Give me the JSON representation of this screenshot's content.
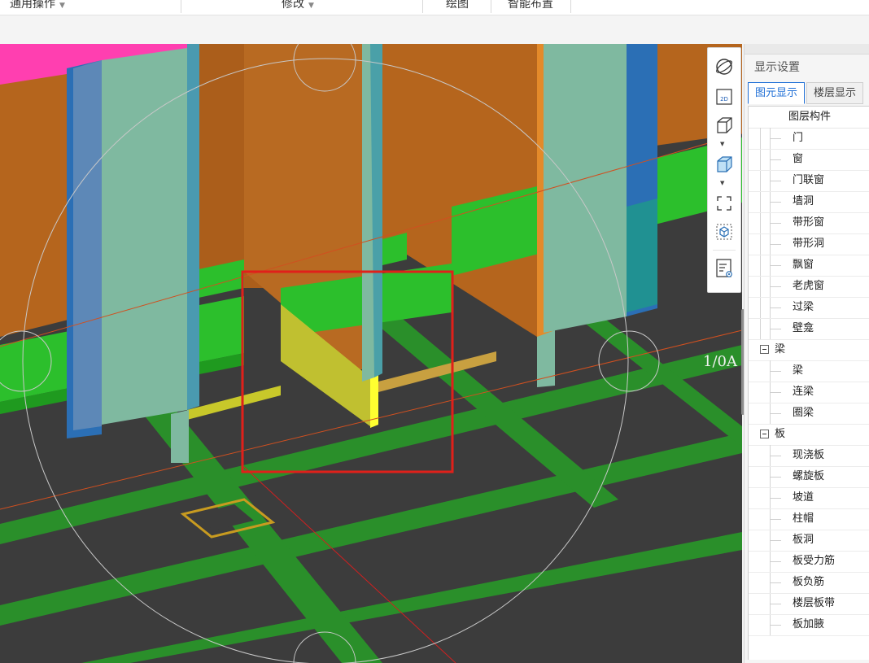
{
  "ribbon": {
    "general_ops": "通用操作",
    "modify": "修改",
    "draw": "绘图",
    "smart_layout": "智能布置"
  },
  "viewport": {
    "axis_label": "1/0A"
  },
  "vertical_toolbar": {
    "icons": [
      "orbit-icon",
      "view-2d-icon",
      "cube-view-icon",
      "solid-view-icon",
      "fit-view-icon",
      "select-region-icon",
      "display-settings-icon"
    ],
    "view_2d_text": "2D"
  },
  "panel": {
    "title": "显示设置",
    "tabs": [
      "图元显示",
      "楼层显示"
    ],
    "active_tab": "图元显示",
    "tree_header": "图层构件",
    "groups": [
      {
        "label": "",
        "items": [
          "门",
          "窗",
          "门联窗",
          "墙洞",
          "带形窗",
          "带形洞",
          "飘窗",
          "老虎窗",
          "过梁",
          "壁龛"
        ]
      },
      {
        "label": "梁",
        "items": [
          "梁",
          "连梁",
          "圈梁"
        ]
      },
      {
        "label": "板",
        "items": [
          "现浇板",
          "螺旋板",
          "坡道",
          "柱帽",
          "板洞",
          "板受力筋",
          "板负筋",
          "楼层板带",
          "板加腋"
        ]
      }
    ]
  },
  "colors": {
    "viewport_bg": "#3c3c3c",
    "wall_brown": "#b5651d",
    "beam_green": "#2cbf2c",
    "wall_yellow": "#c8c82a",
    "selection_red": "#e0201a",
    "column_teal": "#7fb9a0",
    "column_blue": "#2b6fb5",
    "slab_pink": "#ff3fb0",
    "tab_accent": "#1f6fd6"
  }
}
